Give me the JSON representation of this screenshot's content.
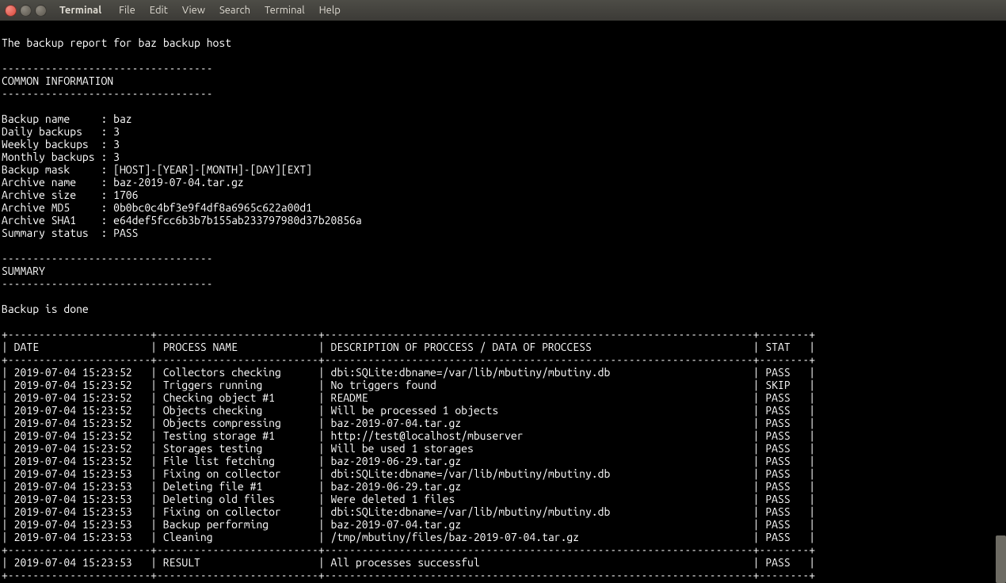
{
  "menubar": {
    "title": "Terminal",
    "items": [
      "File",
      "Edit",
      "View",
      "Search",
      "Terminal",
      "Help"
    ]
  },
  "report": {
    "title": "The backup report for baz backup host",
    "dash_short": "----------------------------------",
    "section_common": "COMMON INFORMATION",
    "common": [
      [
        "Backup name",
        "baz"
      ],
      [
        "Daily backups",
        "3"
      ],
      [
        "Weekly backups",
        "3"
      ],
      [
        "Monthly backups",
        "3"
      ],
      [
        "Backup mask",
        "[HOST]-[YEAR]-[MONTH]-[DAY][EXT]"
      ],
      [
        "Archive name",
        "baz-2019-07-04.tar.gz"
      ],
      [
        "Archive size",
        "1706"
      ],
      [
        "Archive MD5",
        "0b0bc0c4bf3e9f4df8a6965c622a00d1"
      ],
      [
        "Archive SHA1",
        "e64def5fcc6b3b7b155ab233797980d37b20856a"
      ],
      [
        "Summary status",
        "PASS"
      ]
    ],
    "section_summary": "SUMMARY",
    "summary_line": "Backup is done",
    "table": {
      "headers": [
        "DATE",
        "PROCESS NAME",
        "DESCRIPTION OF PROCCESS / DATA OF PROCCESS",
        "STAT"
      ],
      "rows": [
        [
          "2019-07-04 15:23:52",
          "Collectors checking",
          "dbi:SQLite:dbname=/var/lib/mbutiny/mbutiny.db",
          "PASS"
        ],
        [
          "2019-07-04 15:23:52",
          "Triggers running",
          "No triggers found",
          "SKIP"
        ],
        [
          "2019-07-04 15:23:52",
          "Checking object #1",
          "README",
          "PASS"
        ],
        [
          "2019-07-04 15:23:52",
          "Objects checking",
          "Will be processed 1 objects",
          "PASS"
        ],
        [
          "2019-07-04 15:23:52",
          "Objects compressing",
          "baz-2019-07-04.tar.gz",
          "PASS"
        ],
        [
          "2019-07-04 15:23:52",
          "Testing storage #1",
          "http://test@localhost/mbuserver",
          "PASS"
        ],
        [
          "2019-07-04 15:23:52",
          "Storages testing",
          "Will be used 1 storages",
          "PASS"
        ],
        [
          "2019-07-04 15:23:52",
          "File list fetching",
          "baz-2019-06-29.tar.gz",
          "PASS"
        ],
        [
          "2019-07-04 15:23:53",
          "Fixing on collector",
          "dbi:SQLite:dbname=/var/lib/mbutiny/mbutiny.db",
          "PASS"
        ],
        [
          "2019-07-04 15:23:53",
          "Deleting file #1",
          "baz-2019-06-29.tar.gz",
          "PASS"
        ],
        [
          "2019-07-04 15:23:53",
          "Deleting old files",
          "Were deleted 1 files",
          "PASS"
        ],
        [
          "2019-07-04 15:23:53",
          "Fixing on collector",
          "dbi:SQLite:dbname=/var/lib/mbutiny/mbutiny.db",
          "PASS"
        ],
        [
          "2019-07-04 15:23:53",
          "Backup performing",
          "baz-2019-07-04.tar.gz",
          "PASS"
        ],
        [
          "2019-07-04 15:23:53",
          "Cleaning",
          "/tmp/mbutiny/files/baz-2019-07-04.tar.gz",
          "PASS"
        ]
      ],
      "footer": [
        "2019-07-04 15:23:53",
        "RESULT",
        "All processes successful",
        "PASS"
      ]
    }
  }
}
